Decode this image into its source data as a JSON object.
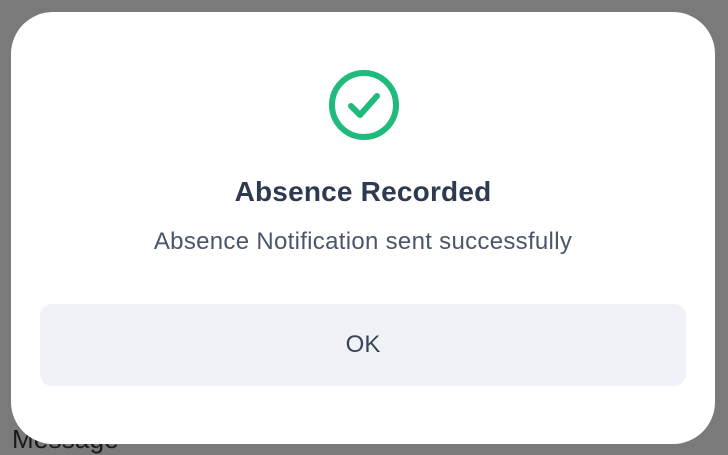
{
  "backdrop": {
    "partial_label": "Message"
  },
  "dialog": {
    "icon": "check-circle-icon",
    "icon_color": "#1fba7c",
    "title": "Absence Recorded",
    "message": "Absence Notification sent successfully",
    "ok_label": "OK"
  }
}
